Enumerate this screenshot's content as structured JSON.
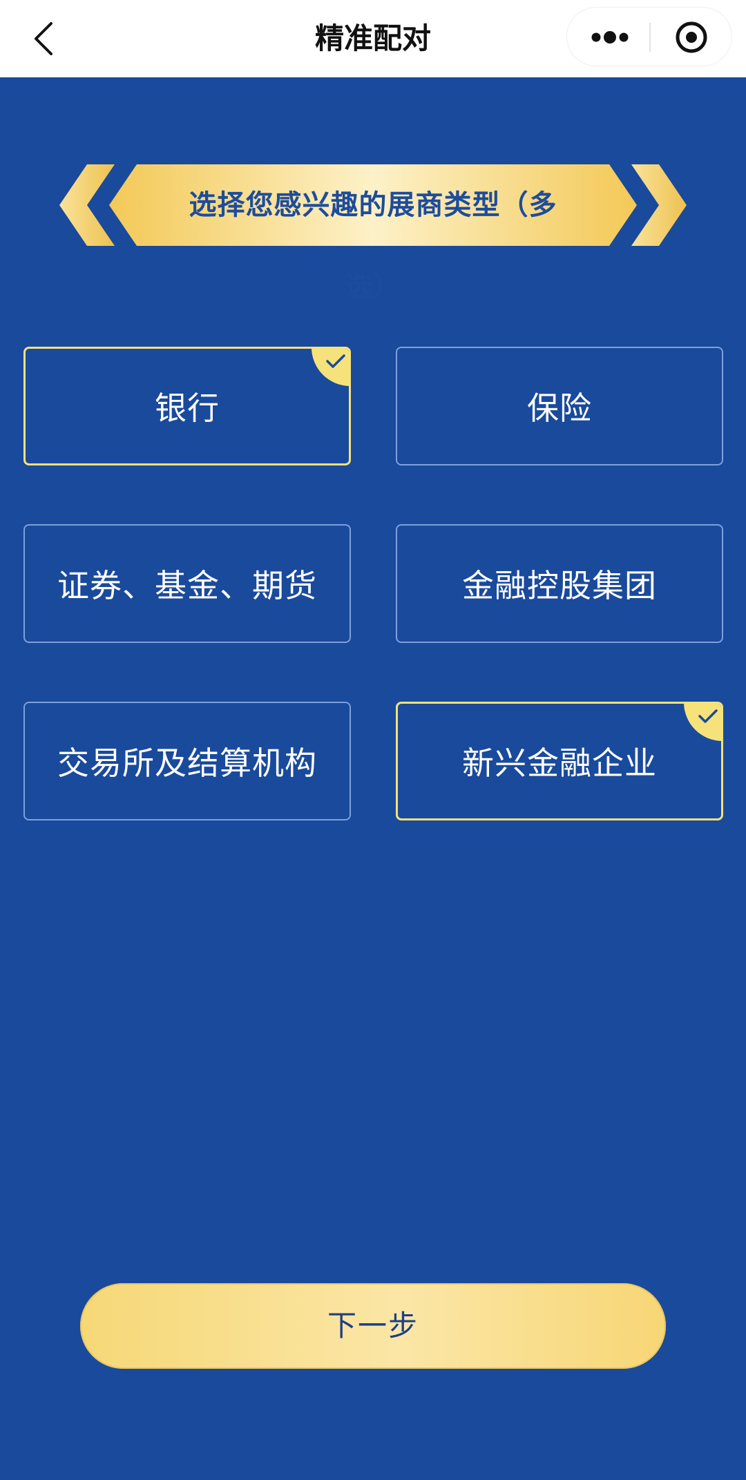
{
  "nav": {
    "title": "精准配对",
    "back_icon": "chevron-left-icon",
    "more_icon": "more-dots-icon",
    "close_icon": "target-circle-icon"
  },
  "heading": {
    "text": "选择您感兴趣的展商类型（多选）"
  },
  "options": [
    {
      "label": "银行",
      "selected": true
    },
    {
      "label": "保险",
      "selected": false
    },
    {
      "label": "证券、基金、期货",
      "selected": false
    },
    {
      "label": "金融控股集团",
      "selected": false
    },
    {
      "label": "交易所及结算机构",
      "selected": false
    },
    {
      "label": "新兴金融企业",
      "selected": true
    }
  ],
  "next_button": {
    "label": "下一步"
  },
  "colors": {
    "background": "#1a4a9c",
    "accent_gold": "#f6e27a",
    "option_border": "#7ea1dd",
    "ribbon_text": "#1d4c9c"
  }
}
